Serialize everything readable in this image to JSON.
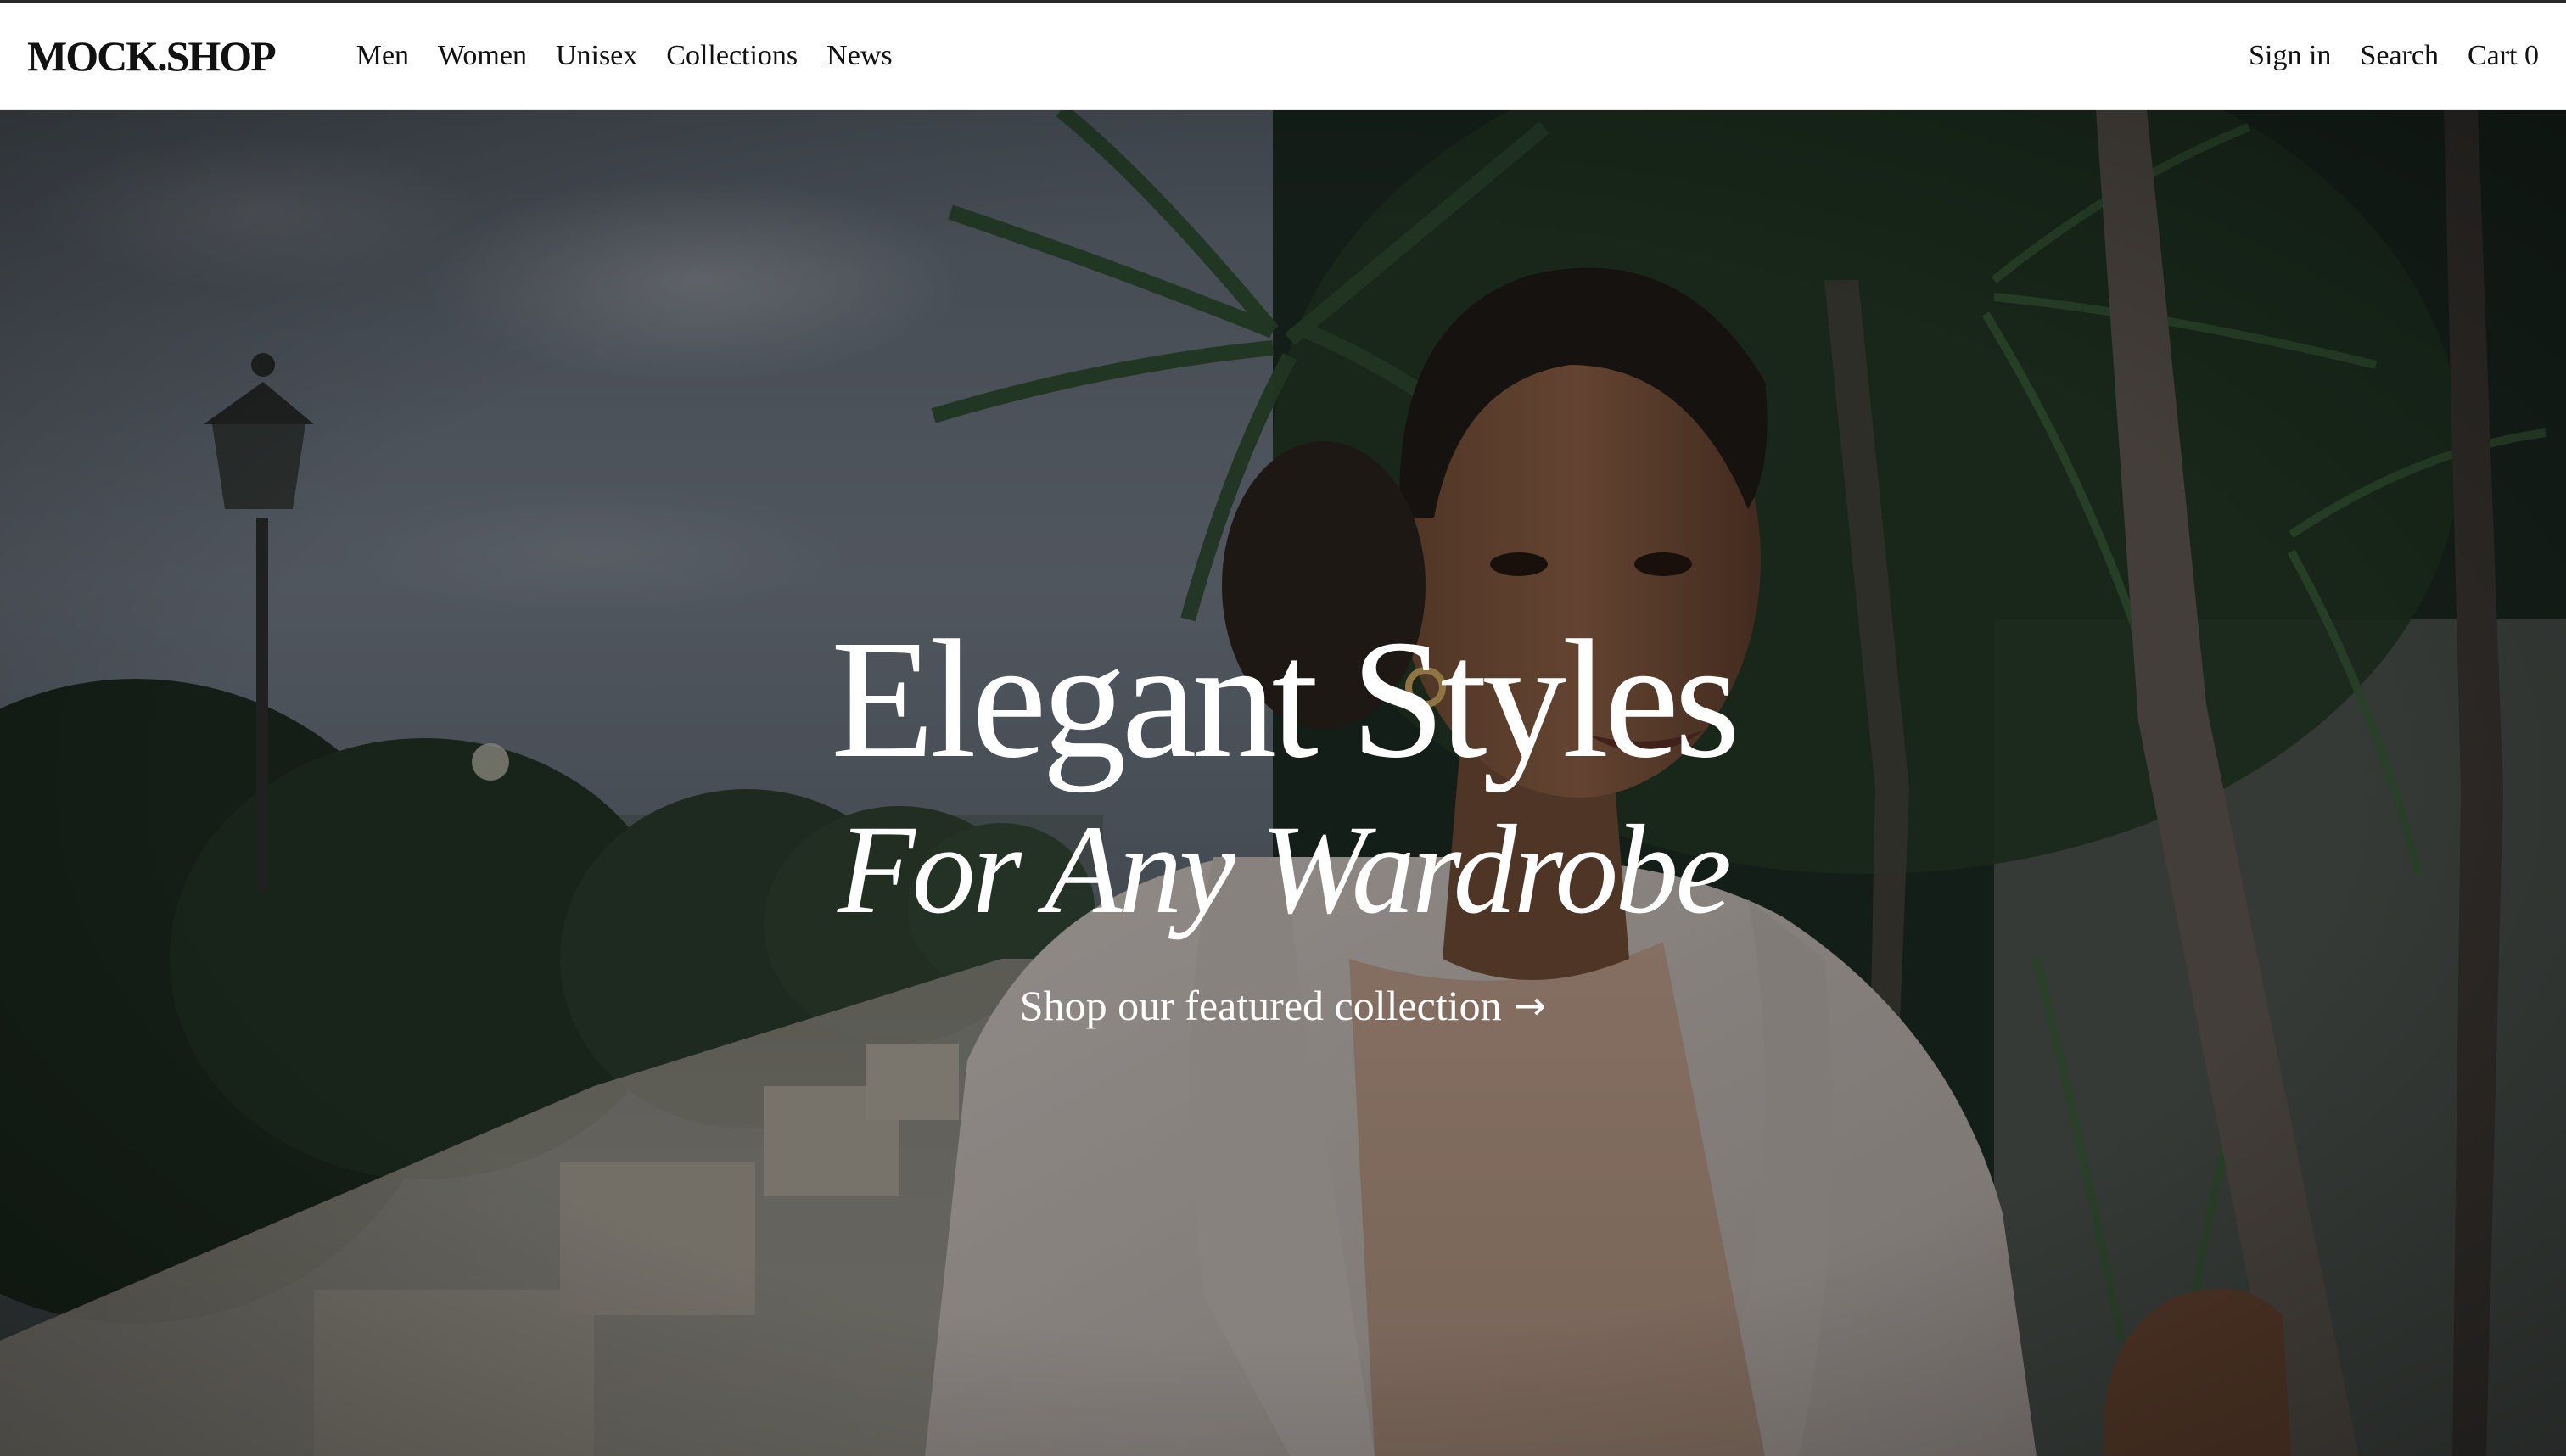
{
  "brand": {
    "logo_text": "MOCK.SHOP"
  },
  "nav": {
    "left": [
      {
        "label": "Men"
      },
      {
        "label": "Women"
      },
      {
        "label": "Unisex"
      },
      {
        "label": "Collections"
      },
      {
        "label": "News"
      }
    ],
    "right": [
      {
        "label": "Sign in"
      },
      {
        "label": "Search"
      },
      {
        "label": "Cart 0"
      }
    ]
  },
  "hero": {
    "title_line_1": "Elegant Styles",
    "title_line_2": "For Any Wardrobe",
    "cta_label": "Shop our featured collection",
    "cta_arrow": "→"
  },
  "colors": {
    "header_bg": "#ffffff",
    "text_dark": "#111111",
    "hero_text": "#ffffff"
  }
}
